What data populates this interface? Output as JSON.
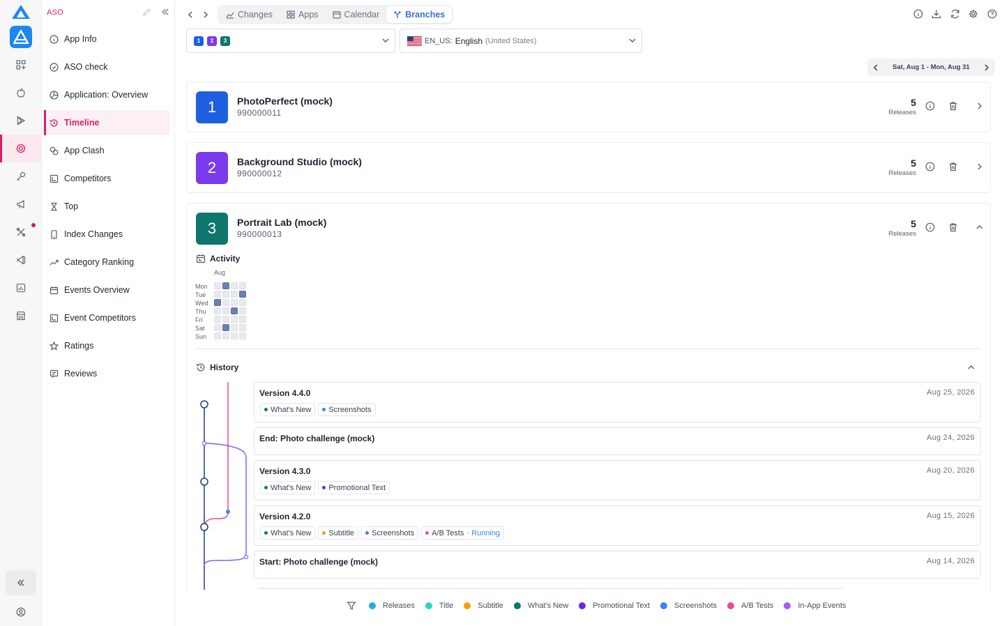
{
  "rail": {
    "items": [
      "apps-grid-icon",
      "apple-icon",
      "play-store-icon",
      "target-icon",
      "key-icon",
      "megaphone-icon",
      "tools-icon",
      "vscode-icon",
      "report-icon",
      "store-icon"
    ],
    "accent": "#d61f69"
  },
  "sidebar": {
    "title": "ASO",
    "items": [
      {
        "label": "App Info",
        "icon": "info-icon"
      },
      {
        "label": "ASO check",
        "icon": "check-circle-icon"
      },
      {
        "label": "Application: Overview",
        "icon": "pie-icon"
      },
      {
        "label": "Timeline",
        "icon": "history-icon",
        "active": true
      },
      {
        "label": "App Clash",
        "icon": "clash-icon"
      },
      {
        "label": "Competitors",
        "icon": "competitors-icon"
      },
      {
        "label": "Top",
        "icon": "hourglass-icon"
      },
      {
        "label": "Index Changes",
        "icon": "phone-icon"
      },
      {
        "label": "Category Ranking",
        "icon": "trend-icon"
      },
      {
        "label": "Events Overview",
        "icon": "calendar-icon"
      },
      {
        "label": "Event Competitors",
        "icon": "competitors-icon"
      },
      {
        "label": "Ratings",
        "icon": "star-icon"
      },
      {
        "label": "Reviews",
        "icon": "reviews-icon"
      }
    ]
  },
  "topnav": {
    "tabs": [
      {
        "label": "Changes",
        "icon": "chart-icon"
      },
      {
        "label": "Apps",
        "icon": "apps-icon"
      },
      {
        "label": "Calendar",
        "icon": "calendar-icon"
      },
      {
        "label": "Branches",
        "icon": "branches-icon",
        "active": true
      }
    ]
  },
  "app_selector": {
    "chips": [
      {
        "label": "1",
        "color": "#1e5fe0"
      },
      {
        "label": "2",
        "color": "#7c3aed"
      },
      {
        "label": "3",
        "color": "#0f766e"
      }
    ]
  },
  "language": {
    "code": "EN_US:",
    "name": "English",
    "region": "(United States)"
  },
  "daterange": {
    "text": "Sat, Aug 1 - Mon, Aug 31"
  },
  "apps": [
    {
      "num": "1",
      "name": "PhotoPerfect (mock)",
      "id": "990000011",
      "releases": "5",
      "releases_label": "Releases",
      "color": "#1e5fe0"
    },
    {
      "num": "2",
      "name": "Background Studio (mock)",
      "id": "990000012",
      "releases": "5",
      "releases_label": "Releases",
      "color": "#7c3aed"
    },
    {
      "num": "3",
      "name": "Portrait Lab (mock)",
      "id": "990000013",
      "releases": "5",
      "releases_label": "Releases",
      "color": "#0f766e"
    }
  ],
  "activity": {
    "title": "Activity",
    "month": "Aug",
    "days": [
      "Mon",
      "Tue",
      "Wed",
      "Thu",
      "Fri",
      "Sat",
      "Sun"
    ],
    "grid": [
      [
        0,
        1,
        0,
        0
      ],
      [
        0,
        0,
        0,
        1
      ],
      [
        1,
        0,
        0,
        0
      ],
      [
        0,
        0,
        1,
        0
      ],
      [
        0,
        0,
        0,
        0
      ],
      [
        0,
        1,
        0,
        0
      ],
      [
        0,
        0,
        0,
        0
      ]
    ]
  },
  "history": {
    "title": "History",
    "events": [
      {
        "title": "Version 4.4.0",
        "date": "Aug 25, 2026",
        "tags": [
          {
            "label": "What's New",
            "color": "#0f766e"
          },
          {
            "label": "Screenshots",
            "color": "#3b82f6"
          }
        ]
      },
      {
        "title": "End: Photo challenge (mock)",
        "date": "Aug 24, 2026",
        "tags": []
      },
      {
        "title": "Version 4.3.0",
        "date": "Aug 20, 2026",
        "tags": [
          {
            "label": "What's New",
            "color": "#0f766e"
          },
          {
            "label": "Promotional Text",
            "color": "#6d28d9"
          }
        ]
      },
      {
        "title": "Version 4.2.0",
        "date": "Aug 15, 2026",
        "tags": [
          {
            "label": "What's New",
            "color": "#0f766e"
          },
          {
            "label": "Subtitle",
            "color": "#f59e0b"
          },
          {
            "label": "Screenshots",
            "color": "#3b82f6"
          },
          {
            "label": "A/B Tests",
            "color": "#ec4899",
            "status": "· Running"
          }
        ]
      },
      {
        "title": "Start: Photo challenge (mock)",
        "date": "Aug 14, 2026",
        "tags": []
      }
    ]
  },
  "legend": [
    {
      "label": "Releases",
      "color": "#22a9e0"
    },
    {
      "label": "Title",
      "color": "#2dd4bf"
    },
    {
      "label": "Subtitle",
      "color": "#f59e0b"
    },
    {
      "label": "What's New",
      "color": "#0f766e"
    },
    {
      "label": "Promotional Text",
      "color": "#6d28d9"
    },
    {
      "label": "Screenshots",
      "color": "#3b82f6"
    },
    {
      "label": "A/B Tests",
      "color": "#ec4899"
    },
    {
      "label": "In-App Events",
      "color": "#a855f7"
    }
  ]
}
